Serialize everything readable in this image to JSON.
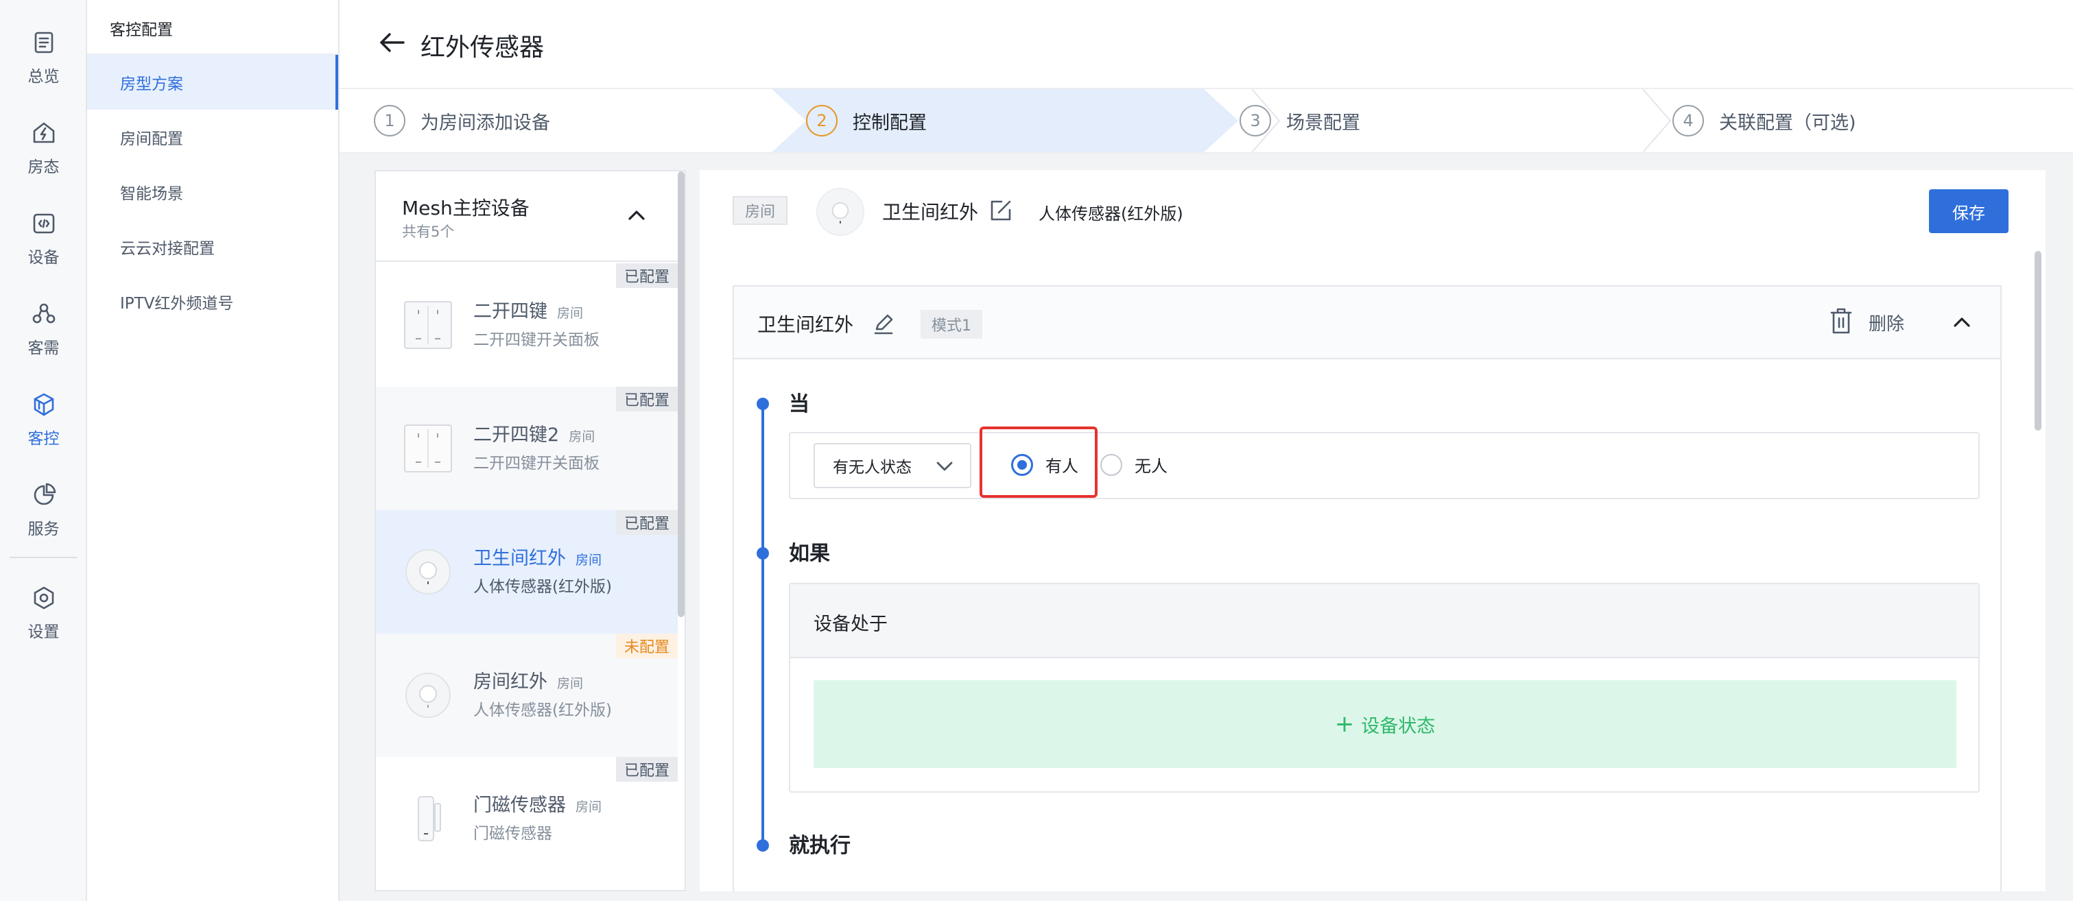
{
  "rail": {
    "items": [
      {
        "label": "总览",
        "icon": "overview-icon"
      },
      {
        "label": "房态",
        "icon": "room-status-icon"
      },
      {
        "label": "设备",
        "icon": "device-icon"
      },
      {
        "label": "客需",
        "icon": "guest-needs-icon"
      },
      {
        "label": "客控",
        "icon": "guest-control-icon",
        "active": true
      },
      {
        "label": "服务",
        "icon": "service-icon"
      },
      {
        "label": "设置",
        "icon": "settings-icon"
      }
    ]
  },
  "submenu": {
    "title": "客控配置",
    "items": [
      {
        "label": "房型方案",
        "active": true
      },
      {
        "label": "房间配置"
      },
      {
        "label": "智能场景"
      },
      {
        "label": "云云对接配置"
      },
      {
        "label": "IPTV红外频道号"
      }
    ]
  },
  "header": {
    "title": "红外传感器"
  },
  "steps": [
    {
      "num": "1",
      "label": "为房间添加设备"
    },
    {
      "num": "2",
      "label": "控制配置",
      "active": true
    },
    {
      "num": "3",
      "label": "场景配置"
    },
    {
      "num": "4",
      "label": "关联配置（可选)"
    }
  ],
  "device_panel": {
    "title": "Mesh主控设备",
    "count": "共有5个",
    "devices": [
      {
        "name": "二开四键",
        "room": "房间",
        "desc": "二开四键开关面板",
        "tag": "已配置"
      },
      {
        "name": "二开四键2",
        "room": "房间",
        "desc": "二开四键开关面板",
        "tag": "已配置"
      },
      {
        "name": "卫生间红外",
        "room": "房间",
        "desc": "人体传感器(红外版)",
        "tag": "已配置",
        "active": true
      },
      {
        "name": "房间红外",
        "room": "房间",
        "desc": "人体传感器(红外版)",
        "tag": "未配置"
      },
      {
        "name": "门磁传感器",
        "room": "房间",
        "desc": "门磁传感器",
        "tag": "已配置"
      }
    ]
  },
  "config": {
    "room_tag": "房间",
    "device_name": "卫生间红外",
    "device_type": "人体传感器(红外版)",
    "save_label": "保存",
    "mode": {
      "name": "卫生间红外",
      "tag": "模式1",
      "delete_label": "删除",
      "when_label": "当",
      "select_value": "有无人状态",
      "radio_options": [
        {
          "label": "有人",
          "checked": true
        },
        {
          "label": "无人",
          "checked": false
        }
      ],
      "if_label": "如果",
      "if_box_title": "设备处于",
      "add_status_label": "设备状态",
      "then_label": "就执行"
    }
  },
  "colors": {
    "accent": "#2f6fdb",
    "highlight": "#e5322d",
    "unconfigured": "#e58a1f",
    "add_status_bg": "#dcf7ea",
    "add_status_text": "#2fb86a"
  }
}
